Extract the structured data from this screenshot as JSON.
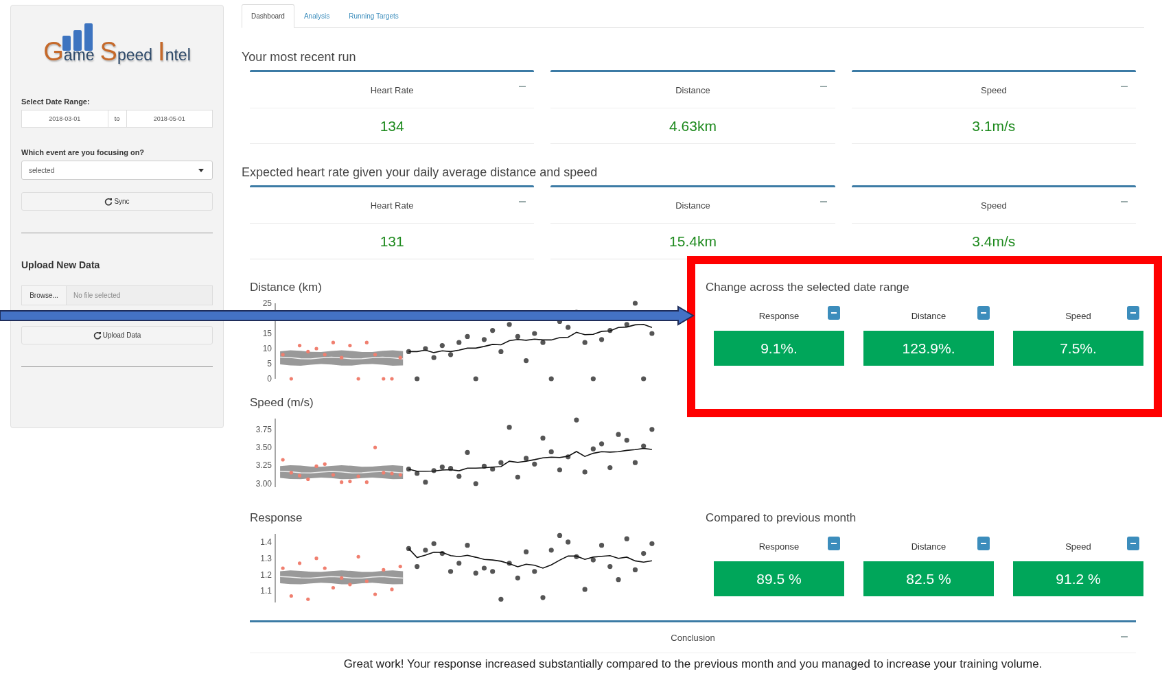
{
  "sidebar": {
    "logo": [
      {
        "initial": "G",
        "rest": "ame"
      },
      {
        "initial": "S",
        "rest": "peed"
      },
      {
        "initial": "I",
        "rest": "ntel"
      }
    ],
    "date_range": {
      "label": "Select Date Range:",
      "start": "2018-03-01",
      "separator": "to",
      "end": "2018-05-01"
    },
    "event": {
      "label": "Which event are you focusing on?",
      "value": "selected"
    },
    "sync_button": "Sync",
    "upload_heading": "Upload New Data",
    "file": {
      "button": "Browse...",
      "placeholder": "No file selected"
    },
    "upload_button": "Upload Data"
  },
  "tabs": [
    {
      "label": "Dashboard",
      "selected": true
    },
    {
      "label": "Analysis",
      "selected": false
    },
    {
      "label": "Running Targets",
      "selected": false
    }
  ],
  "summary_sections": [
    {
      "title": "Your most recent run",
      "boxes": [
        {
          "label": "Heart Rate",
          "value": "134"
        },
        {
          "label": "Distance",
          "value": "4.63km"
        },
        {
          "label": "Speed",
          "value": "3.1m/s"
        }
      ]
    },
    {
      "title": "Expected heart rate given your daily average distance and speed",
      "boxes": [
        {
          "label": "Heart Rate",
          "value": "131"
        },
        {
          "label": "Distance",
          "value": "15.4km"
        },
        {
          "label": "Speed",
          "value": "3.4m/s"
        }
      ]
    }
  ],
  "charts": [
    {
      "title": "Distance (km)",
      "y_labels": [
        "25",
        "15",
        "10",
        "5",
        "0"
      ]
    },
    {
      "title": "Speed (m/s)",
      "y_labels": [
        "3.75",
        "3.50",
        "3.25",
        "3.00"
      ]
    },
    {
      "title": "Response",
      "y_labels": [
        "1.4",
        "1.3",
        "1.2",
        "1.1"
      ]
    }
  ],
  "change_sections": [
    {
      "title": "Change across the selected date range",
      "items": [
        {
          "label": "Response",
          "value": "9.1%."
        },
        {
          "label": "Distance",
          "value": "123.9%."
        },
        {
          "label": "Speed",
          "value": "7.5%."
        }
      ]
    },
    {
      "title": "Compared to previous month",
      "items": [
        {
          "label": "Response",
          "value": "89.5 %"
        },
        {
          "label": "Distance",
          "value": "82.5 %"
        },
        {
          "label": "Speed",
          "value": "91.2 %"
        }
      ]
    }
  ],
  "conclusion": {
    "title": "Conclusion",
    "text": "Great work! Your response increased substantially compared to the previous month and you managed to increase your training volume."
  }
}
